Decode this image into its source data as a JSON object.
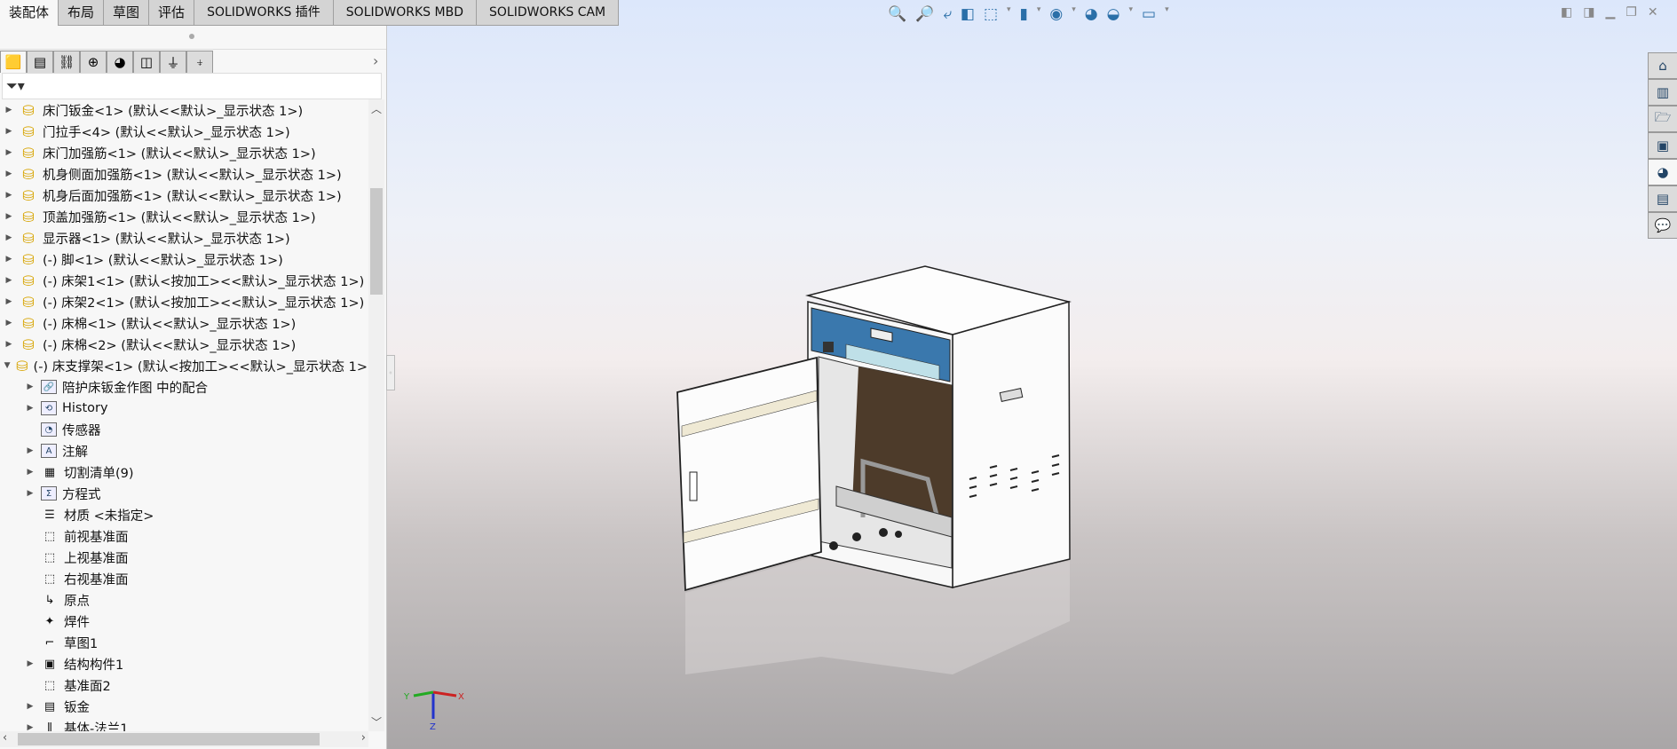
{
  "tabs": [
    "装配体",
    "布局",
    "草图",
    "评估",
    "SOLIDWORKS 插件",
    "SOLIDWORKS MBD",
    "SOLIDWORKS CAM"
  ],
  "panel_tabs": [
    "featuremanager",
    "propertymanager",
    "configurationmanager",
    "dimxpert",
    "displaymanager",
    "cam-feature",
    "cam-operation",
    "cam-tool"
  ],
  "filter_icon": "filter-icon",
  "tree": [
    {
      "label": "床门钣金<1> (默认<<默认>_显示状态 1>)",
      "level": 0,
      "expand": "collapsed",
      "icon": "part"
    },
    {
      "label": "门拉手<4> (默认<<默认>_显示状态 1>)",
      "level": 0,
      "expand": "collapsed",
      "icon": "part"
    },
    {
      "label": "床门加强筋<1> (默认<<默认>_显示状态 1>)",
      "level": 0,
      "expand": "collapsed",
      "icon": "part"
    },
    {
      "label": "机身侧面加强筋<1> (默认<<默认>_显示状态 1>)",
      "level": 0,
      "expand": "collapsed",
      "icon": "part"
    },
    {
      "label": "机身后面加强筋<1> (默认<<默认>_显示状态 1>)",
      "level": 0,
      "expand": "collapsed",
      "icon": "part"
    },
    {
      "label": "顶盖加强筋<1> (默认<<默认>_显示状态 1>)",
      "level": 0,
      "expand": "collapsed",
      "icon": "part"
    },
    {
      "label": "显示器<1> (默认<<默认>_显示状态 1>)",
      "level": 0,
      "expand": "collapsed",
      "icon": "part"
    },
    {
      "label": "(-) 脚<1> (默认<<默认>_显示状态 1>)",
      "level": 0,
      "expand": "collapsed",
      "icon": "part"
    },
    {
      "label": "(-) 床架1<1> (默认<按加工><<默认>_显示状态 1>)",
      "level": 0,
      "expand": "collapsed",
      "icon": "part"
    },
    {
      "label": "(-) 床架2<1> (默认<按加工><<默认>_显示状态 1>)",
      "level": 0,
      "expand": "collapsed",
      "icon": "part"
    },
    {
      "label": "(-) 床棉<1> (默认<<默认>_显示状态 1>)",
      "level": 0,
      "expand": "collapsed",
      "icon": "part"
    },
    {
      "label": "(-) 床棉<2> (默认<<默认>_显示状态 1>)",
      "level": 0,
      "expand": "collapsed",
      "icon": "part"
    },
    {
      "label": "(-) 床支撑架<1> (默认<按加工><<默认>_显示状态 1>",
      "level": 0,
      "expand": "expanded",
      "icon": "part"
    },
    {
      "label": "陪护床钣金作图 中的配合",
      "level": 1,
      "expand": "collapsed",
      "icon": "mates-folder"
    },
    {
      "label": "History",
      "level": 1,
      "expand": "collapsed",
      "icon": "history-folder"
    },
    {
      "label": "传感器",
      "level": 1,
      "expand": "none",
      "icon": "sensor-folder"
    },
    {
      "label": "注解",
      "level": 1,
      "expand": "collapsed",
      "icon": "annotation-folder"
    },
    {
      "label": "切割清单(9)",
      "level": 1,
      "expand": "collapsed",
      "icon": "cut-list"
    },
    {
      "label": "方程式",
      "level": 1,
      "expand": "collapsed",
      "icon": "equation-folder"
    },
    {
      "label": "材质 <未指定>",
      "level": 1,
      "expand": "none",
      "icon": "material"
    },
    {
      "label": "前视基准面",
      "level": 1,
      "expand": "none",
      "icon": "plane"
    },
    {
      "label": "上视基准面",
      "level": 1,
      "expand": "none",
      "icon": "plane"
    },
    {
      "label": "右视基准面",
      "level": 1,
      "expand": "none",
      "icon": "plane"
    },
    {
      "label": "原点",
      "level": 1,
      "expand": "none",
      "icon": "origin"
    },
    {
      "label": "焊件",
      "level": 1,
      "expand": "none",
      "icon": "weldment"
    },
    {
      "label": "草图1",
      "level": 1,
      "expand": "none",
      "icon": "sketch"
    },
    {
      "label": "结构构件1",
      "level": 1,
      "expand": "collapsed",
      "icon": "structural-member"
    },
    {
      "label": "基准面2",
      "level": 1,
      "expand": "none",
      "icon": "plane"
    },
    {
      "label": "钣金",
      "level": 1,
      "expand": "collapsed",
      "icon": "sheet-metal"
    },
    {
      "label": "基体-法兰1",
      "level": 1,
      "expand": "collapsed",
      "icon": "base-flange"
    }
  ],
  "view_toolbar": [
    "zoom-to-fit",
    "zoom-to-area",
    "previous-view",
    "section-view",
    "view-orientation",
    "display-style",
    "hide-show-items",
    "edit-appearance",
    "apply-scene",
    "view-settings"
  ],
  "task_pane": [
    "home",
    "design-library",
    "file-explorer",
    "view-palette",
    "appearances",
    "custom-properties",
    "forum"
  ],
  "triad": {
    "x": "X",
    "y": "Y",
    "z": "Z"
  },
  "colors": {
    "accent": "#2b6ea8",
    "panel_blue": "#3a78ad"
  }
}
